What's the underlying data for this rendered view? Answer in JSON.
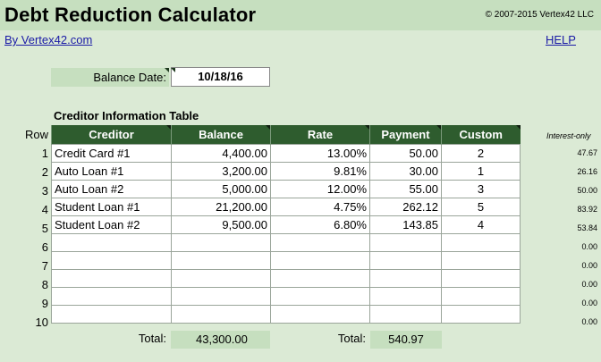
{
  "header": {
    "title": "Debt Reduction Calculator",
    "copyright": "© 2007-2015 Vertex42 LLC"
  },
  "links": {
    "by": "By Vertex42.com",
    "help": "HELP"
  },
  "balance_date": {
    "label": "Balance Date:",
    "value": "10/18/16"
  },
  "table": {
    "caption": "Creditor Information Table",
    "row_header": "Row",
    "interest_header": "Interest-only",
    "columns": [
      "Creditor",
      "Balance",
      "Rate",
      "Payment",
      "Custom"
    ],
    "rows": [
      {
        "num": "1",
        "creditor": "Credit Card #1",
        "balance": "4,400.00",
        "rate": "13.00%",
        "payment": "50.00",
        "custom": "2",
        "interest": "47.67"
      },
      {
        "num": "2",
        "creditor": "Auto Loan #1",
        "balance": "3,200.00",
        "rate": "9.81%",
        "payment": "30.00",
        "custom": "1",
        "interest": "26.16"
      },
      {
        "num": "3",
        "creditor": "Auto Loan #2",
        "balance": "5,000.00",
        "rate": "12.00%",
        "payment": "55.00",
        "custom": "3",
        "interest": "50.00"
      },
      {
        "num": "4",
        "creditor": "Student Loan #1",
        "balance": "21,200.00",
        "rate": "4.75%",
        "payment": "262.12",
        "custom": "5",
        "interest": "83.92"
      },
      {
        "num": "5",
        "creditor": "Student Loan #2",
        "balance": "9,500.00",
        "rate": "6.80%",
        "payment": "143.85",
        "custom": "4",
        "interest": "53.84"
      },
      {
        "num": "6",
        "creditor": "",
        "balance": "",
        "rate": "",
        "payment": "",
        "custom": "",
        "interest": "0.00"
      },
      {
        "num": "7",
        "creditor": "",
        "balance": "",
        "rate": "",
        "payment": "",
        "custom": "",
        "interest": "0.00"
      },
      {
        "num": "8",
        "creditor": "",
        "balance": "",
        "rate": "",
        "payment": "",
        "custom": "",
        "interest": "0.00"
      },
      {
        "num": "9",
        "creditor": "",
        "balance": "",
        "rate": "",
        "payment": "",
        "custom": "",
        "interest": "0.00"
      },
      {
        "num": "10",
        "creditor": "",
        "balance": "",
        "rate": "",
        "payment": "",
        "custom": "",
        "interest": "0.00"
      }
    ]
  },
  "totals": {
    "balance_label": "Total:",
    "balance_value": "43,300.00",
    "payment_label": "Total:",
    "payment_value": "540.97"
  },
  "colors": {
    "header_green": "#2e5c2e",
    "panel_green": "#c6dfbf",
    "background": "#dbead5",
    "link": "#1a1aa6"
  }
}
